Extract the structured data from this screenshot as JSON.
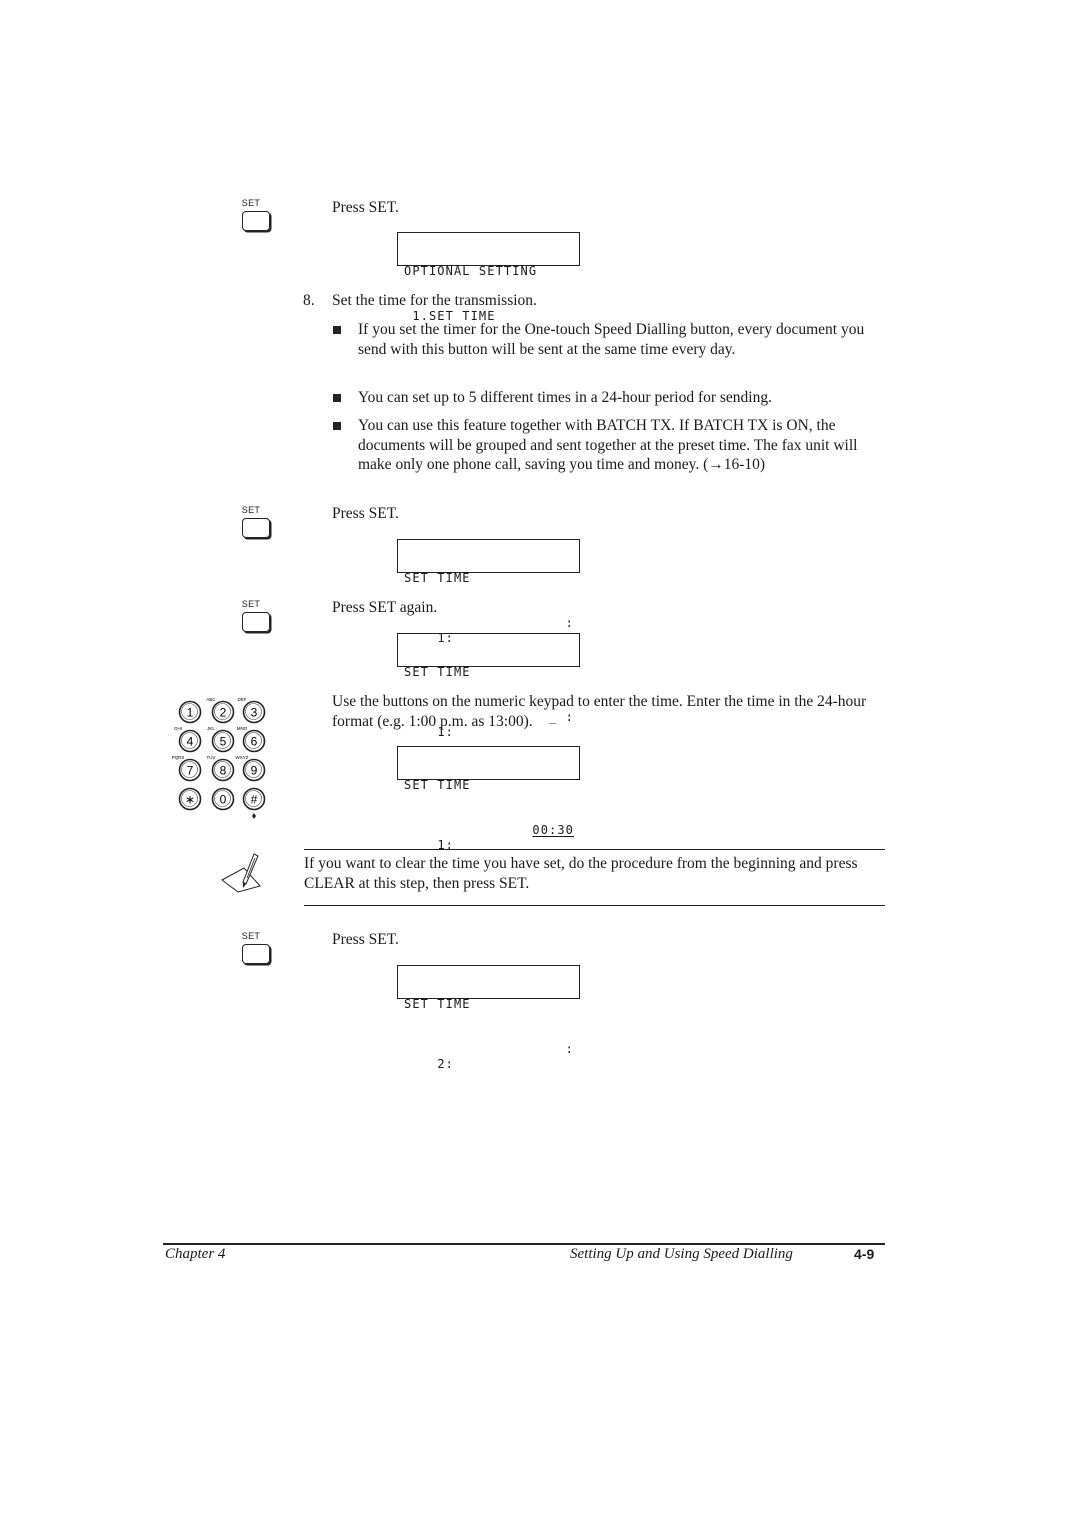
{
  "set_key_label": "SET",
  "steps": {
    "press_set_1": "Press SET.",
    "lcd_1": {
      "line1": "OPTIONAL SETTING",
      "line2": " 1.SET TIME"
    },
    "step8": {
      "number": "8.",
      "text": "Set the time for the transmission."
    },
    "bullets": [
      "If you set the timer for the One-touch Speed Dialling button, every document you send with this button will be sent at the same time every day.",
      "You can set up to 5 different times in a 24-hour period for sending.",
      "You can use this feature together with BATCH TX. If BATCH TX is ON, the documents will be grouped and sent together at the preset time. The fax unit will make only one phone call, saving you time and money. (→16-10)"
    ],
    "press_set_2": "Press SET.",
    "lcd_2": {
      "line1": "SET TIME",
      "line2_left": "1:",
      "line2_right": ":"
    },
    "press_set_again": "Press SET again.",
    "lcd_3": {
      "line1": "SET TIME",
      "line2_left": "1:",
      "line2_right": "_ :"
    },
    "keypad_instruction": "Use the buttons on the numeric keypad to enter the time. Enter the time in the 24-hour format (e.g. 1:00 p.m. as 13:00).",
    "lcd_4": {
      "line1": "SET TIME",
      "line2_left": "1:",
      "line2_right": "00:30"
    },
    "note": "If you want to clear the time you have set, do the procedure from the beginning and press CLEAR at this step, then press SET.",
    "press_set_3": "Press SET.",
    "lcd_5": {
      "line1": "SET TIME",
      "line2_left": "2:",
      "line2_right": ":"
    }
  },
  "keypad": {
    "keys": [
      {
        "digit": "1",
        "letters": ""
      },
      {
        "digit": "2",
        "letters": "ABC"
      },
      {
        "digit": "3",
        "letters": "DEF"
      },
      {
        "digit": "4",
        "letters": "GHI"
      },
      {
        "digit": "5",
        "letters": "JKL"
      },
      {
        "digit": "6",
        "letters": "MNO"
      },
      {
        "digit": "7",
        "letters": "PQRS"
      },
      {
        "digit": "8",
        "letters": "TUV"
      },
      {
        "digit": "9",
        "letters": "WXYZ"
      },
      {
        "digit": "∗",
        "letters": ""
      },
      {
        "digit": "0",
        "letters": ""
      },
      {
        "digit": "#",
        "letters": ""
      }
    ]
  },
  "footer": {
    "chapter": "Chapter 4",
    "section": "Setting Up and Using Speed Dialling",
    "page": "4-9"
  }
}
